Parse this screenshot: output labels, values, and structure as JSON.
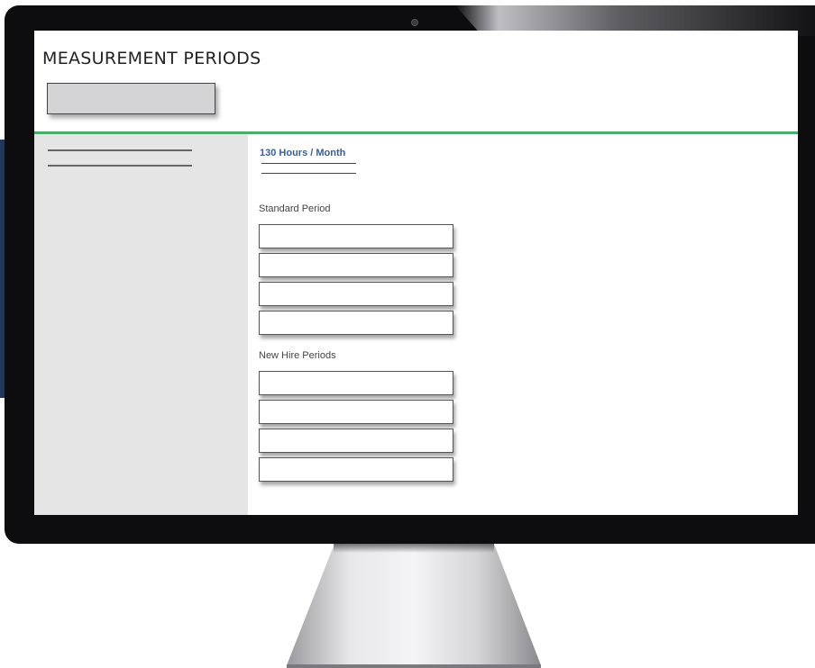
{
  "page": {
    "title": "MEASUREMENT PERIODS",
    "subtitle": "130 Hours /  Month"
  },
  "sections": {
    "standard_label": "Standard Period",
    "new_hire_label": "New Hire Periods"
  },
  "fields": {
    "standard_count": 4,
    "new_hire_count": 4
  },
  "colors": {
    "accent_green": "#4faa6f",
    "subtitle_blue": "#3a5f8f",
    "sidebar_bg": "#e5e5e5",
    "monitor_bezel": "#0d0d0f"
  }
}
